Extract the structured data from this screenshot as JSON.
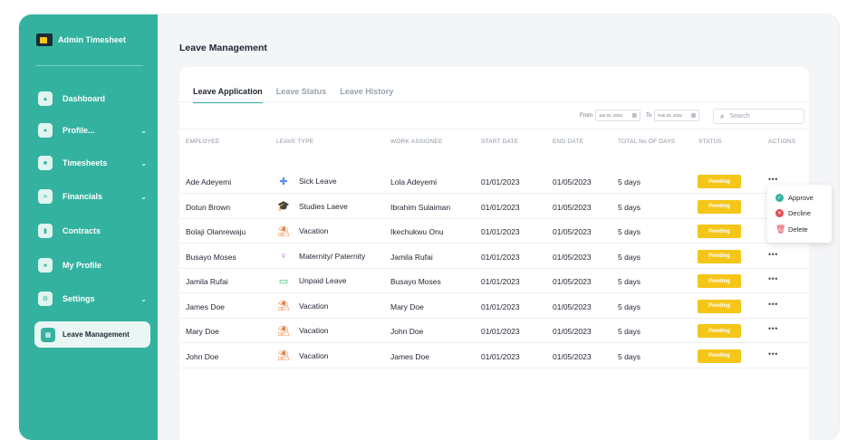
{
  "app": {
    "name": "Admin Timesheet"
  },
  "sidebar": {
    "items": [
      {
        "label": "Dashboard",
        "icon": "home-icon",
        "chevron": false
      },
      {
        "label": "Profile...",
        "icon": "profile-icon",
        "chevron": true
      },
      {
        "label": "Timesheets",
        "icon": "timesheet-icon",
        "chevron": true
      },
      {
        "label": "Financials",
        "icon": "financials-icon",
        "chevron": true
      },
      {
        "label": "Contracts",
        "icon": "contracts-icon",
        "chevron": false
      },
      {
        "label": "My Profile",
        "icon": "user-icon",
        "chevron": false
      },
      {
        "label": "Settings",
        "icon": "settings-icon",
        "chevron": true
      }
    ],
    "active": {
      "label": "Leave Management",
      "icon": "calendar-icon"
    }
  },
  "page": {
    "title": "Leave Management"
  },
  "tabs": [
    {
      "label": "Leave Application",
      "active": true
    },
    {
      "label": "Leave Status",
      "active": false
    },
    {
      "label": "Leave History",
      "active": false
    }
  ],
  "filter": {
    "from_label": "From",
    "from_value": "Jan 01, 2022",
    "to_label": "To",
    "to_value": "Feb 20, 2022",
    "search_placeholder": "Search"
  },
  "table": {
    "columns": [
      "EMPLOYEE",
      "LEAVE TYPE",
      "WORK ASSIGNEE",
      "START DATE",
      "END DATE",
      "TOTAL No OF DAYS",
      "STATUS",
      "ACTIONS"
    ],
    "rows": [
      {
        "employee": "Ade Adeyemi",
        "leave_type": "Sick Leave",
        "leave_icon": "bandage-icon",
        "assignee": "Lola Adeyemi",
        "start": "01/01/2023",
        "end": "01/05/2023",
        "days": "5 days",
        "status": "Pending"
      },
      {
        "employee": "Dotun Brown",
        "leave_type": "Studies Laeve",
        "leave_icon": "graduation-cap-icon",
        "assignee": "Ibrahim Sulaiman",
        "start": "01/01/2023",
        "end": "01/05/2023",
        "days": "5 days",
        "status": "Pending"
      },
      {
        "employee": "Bolaji Olanrewaju",
        "leave_type": "Vacation",
        "leave_icon": "beach-umbrella-icon",
        "assignee": "Ikechukwu Onu",
        "start": "01/01/2023",
        "end": "01/05/2023",
        "days": "5 days",
        "status": "Pending"
      },
      {
        "employee": "Busayo Moses",
        "leave_type": "Maternity/ Paternity",
        "leave_icon": "mother-icon",
        "assignee": "Jamila Rufai",
        "start": "01/01/2023",
        "end": "01/05/2023",
        "days": "5 days",
        "status": "Pending"
      },
      {
        "employee": "Jamila Rufai",
        "leave_type": "Unpaid Leave",
        "leave_icon": "money-icon",
        "assignee": "Busayo Moses",
        "start": "01/01/2023",
        "end": "01/05/2023",
        "days": "5 days",
        "status": "Pending"
      },
      {
        "employee": "James Doe",
        "leave_type": "Vacation",
        "leave_icon": "beach-umbrella-icon",
        "assignee": "Mary Doe",
        "start": "01/01/2023",
        "end": "01/05/2023",
        "days": "5 days",
        "status": "Pending"
      },
      {
        "employee": "Mary Doe",
        "leave_type": "Vacation",
        "leave_icon": "beach-umbrella-icon",
        "assignee": "John Doe",
        "start": "01/01/2023",
        "end": "01/05/2023",
        "days": "5 days",
        "status": "Pending"
      },
      {
        "employee": "John Doe",
        "leave_type": "Vacation",
        "leave_icon": "beach-umbrella-icon",
        "assignee": "James Doe",
        "start": "01/01/2023",
        "end": "01/05/2023",
        "days": "5 days",
        "status": "Pending"
      }
    ],
    "actions_symbol": "•••"
  },
  "action_menu": {
    "items": [
      {
        "label": "Approve",
        "icon": "check-circle-icon",
        "color": "#33b2a0"
      },
      {
        "label": "Decline",
        "icon": "x-circle-icon",
        "color": "#e5484d"
      },
      {
        "label": "Delete",
        "icon": "trash-icon",
        "color": "#e5484d"
      }
    ]
  },
  "colors": {
    "accent": "#33b2a0",
    "pending": "#f5c518",
    "danger": "#e5484d"
  }
}
